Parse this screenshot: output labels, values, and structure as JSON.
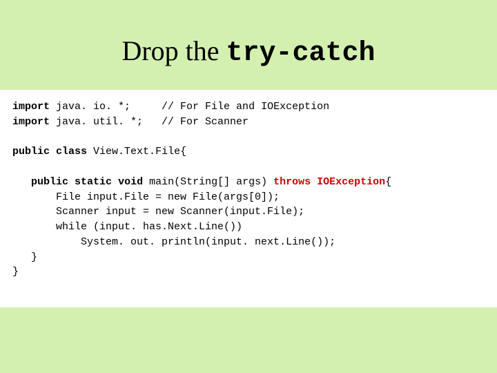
{
  "title": {
    "prefix": "Drop the ",
    "mono": "try-catch"
  },
  "code": {
    "l1_kw": "import",
    "l1_rest": " java. io. *;     // For File and IOException",
    "l2_kw": "import",
    "l2_rest": " java. util. *;   // For Scanner",
    "blank1": "",
    "l3_kw1": "public",
    "l3_mid": " ",
    "l3_kw2": "class",
    "l3_rest": " View.Text.File{",
    "blank2": "",
    "l4_indent": "   ",
    "l4_kw1": "public",
    "l4_sp1": " ",
    "l4_kw2": "static",
    "l4_sp2": " ",
    "l4_kw3": "void",
    "l4_mid": " main(String[] args) ",
    "l4_kw4": "throws",
    "l4_sp3": " ",
    "l4_exc": "IOException",
    "l4_end": "{",
    "l5": "       File input.File = new File(args[0]);",
    "l6": "       Scanner input = new Scanner(input.File);",
    "l7": "       while (input. has.Next.Line())",
    "l8": "           System. out. println(input. next.Line());",
    "l9": "   }",
    "l10": "}"
  }
}
